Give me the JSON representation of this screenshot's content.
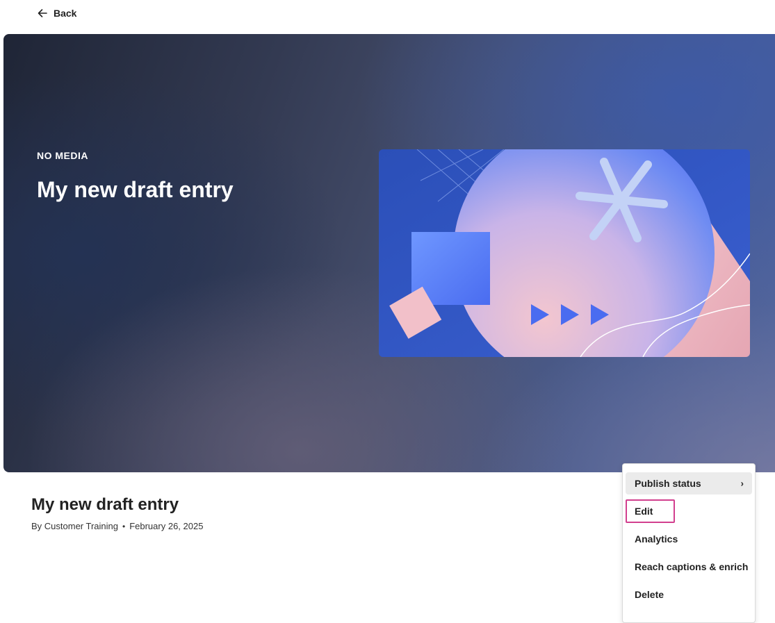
{
  "nav": {
    "back_label": "Back"
  },
  "hero": {
    "kicker": "NO MEDIA",
    "title": "My new draft entry"
  },
  "entry": {
    "title": "My new draft entry",
    "author": "By Customer Training",
    "separator": "•",
    "date": "February 26, 2025"
  },
  "menu": {
    "items": [
      {
        "label": "Publish status",
        "has_submenu": true
      },
      {
        "label": "Edit"
      },
      {
        "label": "Analytics"
      },
      {
        "label": "Reach captions & enrich"
      },
      {
        "label": "Delete"
      }
    ],
    "submenu_chevron": "›",
    "highlight_color": "#d23f8e"
  },
  "colors": {
    "thumb_blue": "#4a6cf0",
    "thumb_pink": "#f0c2cc"
  }
}
